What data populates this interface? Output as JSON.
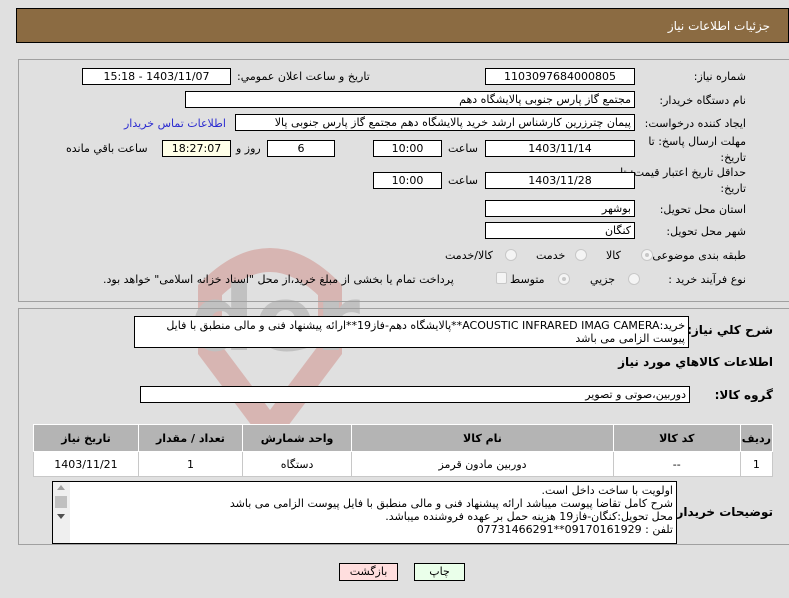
{
  "header": {
    "title": "جزئيات اطلاعات نياز"
  },
  "fields": {
    "need_number": {
      "label": "شماره نياز:",
      "value": "1103097684000805"
    },
    "announce_datetime": {
      "label": "تاريخ و ساعت اعلان عمومي:",
      "value": "1403/11/07 - 15:18"
    },
    "buyer_org": {
      "label": "نام دستگاه خريدار:",
      "value": "مجتمع گاز پارس جنوبی  پالایشگاه دهم"
    },
    "requester": {
      "label": "ايجاد کننده درخواست:",
      "value": "پيمان چترزرين کارشناس ارشد خريد پالايشگاه دهم مجتمع گاز پارس جنوبی  پالا",
      "contact_link": "اطلاعات تماس خريدار"
    },
    "reply_deadline": {
      "label_line1": "مهلت ارسال پاسخ: تا",
      "label_line2": "تاريخ:",
      "date": "1403/11/14",
      "time_label": "ساعت",
      "time": "10:00",
      "days": "6",
      "days_label": "روز و",
      "remaining": "18:27:07",
      "remaining_label": "ساعت باقي مانده"
    },
    "price_validity": {
      "label_line1": "حداقل تاريخ اعتبار قيمت: تا",
      "label_line2": "تاريخ:",
      "date": "1403/11/28",
      "time_label": "ساعت",
      "time": "10:00"
    },
    "province": {
      "label": "استان محل تحويل:",
      "value": "بوشهر"
    },
    "city": {
      "label": "شهر محل تحويل:",
      "value": "کنگان"
    },
    "category": {
      "label": "طبقه بندی موضوعی:",
      "options": [
        "کالا",
        "خدمت",
        "کالا/خدمت"
      ],
      "selected": "کالا"
    },
    "purchase_type": {
      "label": "نوع فرآيند خريد :",
      "options": [
        "جزيي",
        "متوسط"
      ],
      "selected": "متوسط",
      "treasury_checkbox_label": "پرداخت تمام يا بخشی از مبلغ خريد،از محل \"اسناد خزانه اسلامی\" خواهد بود."
    }
  },
  "description": {
    "label": "شرح كلي نياز:",
    "value": "خريد:ACOUSTIC INFRARED IMAG CAMERA**پالايشگاه دهم-فاز19**ارائه پيشنهاد فنی و مالی منطبق با فايل پيوست الزامی می باشد"
  },
  "goods_section": {
    "title": "اطلاعات كالاهاي مورد نياز",
    "group_label": "گروه كالا:",
    "group_value": "دوربين،صوتی و تصوير",
    "table": {
      "headers": [
        "رديف",
        "کد کالا",
        "نام کالا",
        "واحد شمارش",
        "تعداد / مقدار",
        "تاريخ نياز"
      ],
      "rows": [
        [
          "1",
          "--",
          "دوربين مادون قرمز",
          "دستگاه",
          "1",
          "1403/11/21"
        ]
      ]
    }
  },
  "buyer_notes": {
    "label": "توضيحات خريدار:",
    "lines": [
      "اولويت با ساخت داخل است.",
      "شرح کامل تقاضا پيوست ميباشد ارائه پيشنهاد فنی و مالی منطبق با فايل پيوست الزامی می باشد",
      "محل تحويل:کنگان-فاز19 هزينه حمل بر عهده فروشنده ميباشد.",
      "تلفن : 09170161929**07731466291"
    ]
  },
  "buttons": {
    "print": "چاپ",
    "back": "بازگشت"
  },
  "colors": {
    "header_bg": "#8b6b42",
    "print_bg": "#eaffea",
    "back_bg": "#ffdede",
    "link": "#2b2bd0"
  }
}
